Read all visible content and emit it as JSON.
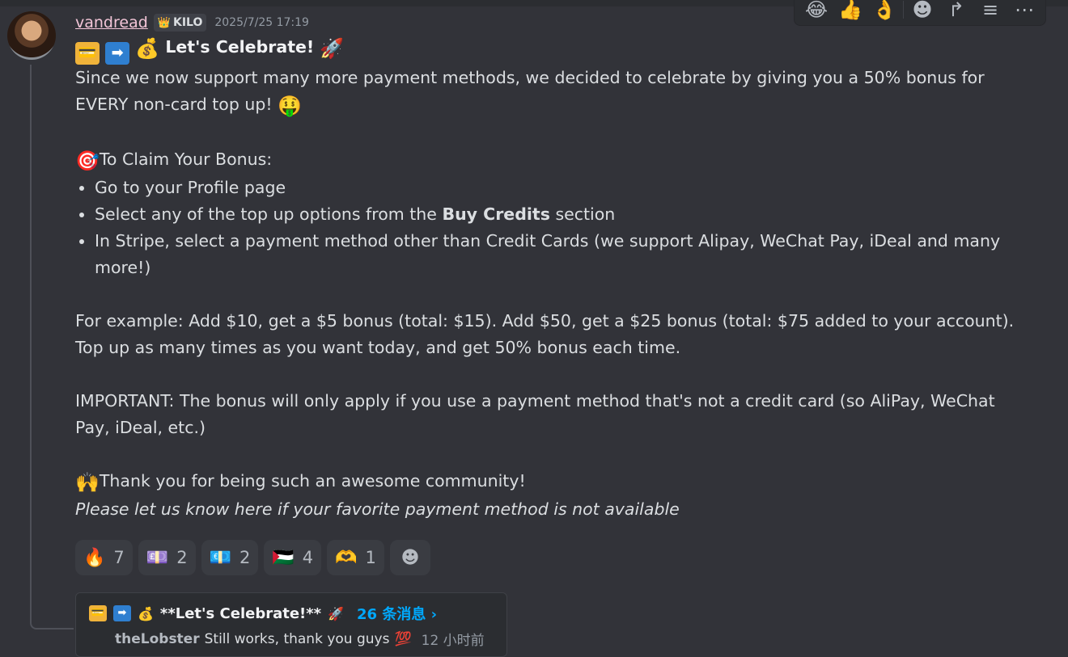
{
  "message": {
    "username": "vandread",
    "guild_tag": {
      "icon": "👑",
      "label": "KILO"
    },
    "timestamp": "2025/7/25 17:19",
    "title": "Let's Celebrate!",
    "title_emojis": {
      "card": "💳",
      "arrow": "➡",
      "money": "💰",
      "rocket": "🚀"
    },
    "intro": "Since we now support many more payment methods, we decided to celebrate by giving you a 50% bonus for EVERY non-card top up!",
    "intro_emoji": "🤑",
    "claim_emoji": "🎯",
    "claim_heading": "To Claim Your Bonus:",
    "steps": [
      {
        "text": "Go to your Profile page"
      },
      {
        "before": "Select any of the top up options from the ",
        "bold": "Buy Credits",
        "after": " section"
      },
      {
        "text": "In Stripe, select a payment method other than Credit Cards (we support Alipay, WeChat Pay, iDeal and many more!)"
      }
    ],
    "example": "For example: Add $10, get a $5 bonus (total: $15). Add $50, get a $25 bonus (total: $75 added to your account). Top up as many times as you want today, and get 50% bonus each time.",
    "important": "IMPORTANT: The bonus will only apply if you use a payment method that's not a credit card (so AliPay, WeChat Pay, iDeal, etc.)",
    "thanks_emoji": "🙌",
    "thanks": "Thank you for being such an awesome community!",
    "footer_italic": "Please let us know here if your favorite payment method is not available"
  },
  "toolbar": {
    "quick_reactions": [
      "😂",
      "👍",
      "👌"
    ],
    "icons": [
      "add-reaction-icon",
      "reply-icon",
      "thread-icon",
      "more-icon"
    ],
    "glyphs": {
      "add_reaction": "☻",
      "reply": "↱",
      "thread": "≡",
      "more": "⋯"
    }
  },
  "reactions": [
    {
      "emoji": "🔥",
      "count": "7"
    },
    {
      "emoji": "💷",
      "count": "2"
    },
    {
      "emoji": "💶",
      "count": "2"
    },
    {
      "emoji": "🇵🇸",
      "count": "4"
    },
    {
      "emoji": "🫶",
      "count": "1"
    }
  ],
  "add_reaction_glyph": "☻",
  "thread": {
    "emojis": {
      "card": "💳",
      "arrow": "➡",
      "money": "💰",
      "rocket": "🚀"
    },
    "title": "**Let's Celebrate!**",
    "count_label": "26 条消息 ›",
    "last_user": "theLobster",
    "last_message": "Still works, thank you guys",
    "last_emoji": "💯",
    "last_time": "12 小时前"
  },
  "colors": {
    "background": "#323339",
    "username": "#f2c5d7",
    "link": "#00a8fc",
    "muted": "#949ba4"
  }
}
